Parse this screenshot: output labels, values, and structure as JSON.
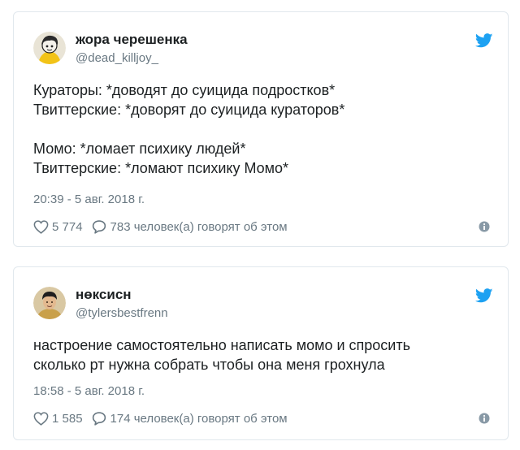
{
  "tweets": [
    {
      "display_name": "жора черешенка",
      "screen_name": "@dead_killjoy_",
      "avatar_icon": "cartoon-avatar",
      "text_lines": [
        "Кураторы: *доводят до суицида подростков*",
        "Твиттерские: *доворят до суицида кураторов*",
        "",
        "Момо: *ломает психику людей*",
        "Твиттерские: *ломают психику Момо*"
      ],
      "timestamp": "20:39 - 5 авг. 2018 г.",
      "likes": "5 774",
      "replies_text": "783 человек(а) говорят об этом"
    },
    {
      "display_name": "нөксисн",
      "screen_name": "@tylersbestfrenn",
      "avatar_icon": "photo-avatar",
      "text_lines": [
        "настроение самостоятельно написать момо и спросить",
        "сколько рт нужна собрать чтобы она меня грохнула"
      ],
      "timestamp": "18:58 - 5 авг. 2018 г.",
      "likes": "1 585",
      "replies_text": "174 человек(а) говорят об этом"
    }
  ],
  "colors": {
    "twitter_blue": "#1da1f2",
    "meta_gray": "#697882",
    "text": "#1c2022",
    "border": "#e1e8ed"
  },
  "icons": {
    "brand": "twitter-bird-icon",
    "like": "heart-icon",
    "reply": "speech-bubble-icon",
    "info": "info-icon"
  }
}
